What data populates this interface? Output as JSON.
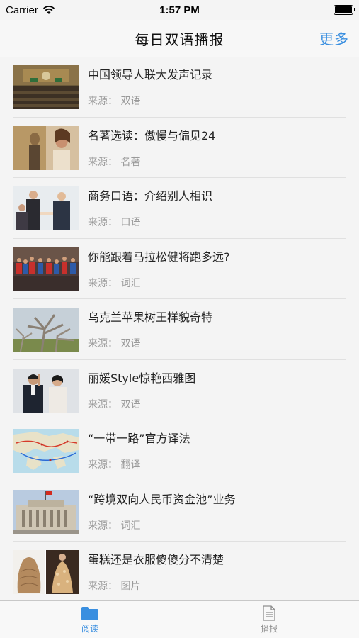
{
  "status_bar": {
    "carrier": "Carrier",
    "time": "1:57 PM"
  },
  "navbar": {
    "title": "每日双语播报",
    "more_label": "更多"
  },
  "articles": [
    {
      "title": "中国领导人联大发声记录",
      "source": "来源： 双语"
    },
    {
      "title": "名著选读：傲慢与偏见24",
      "source": "来源： 名著"
    },
    {
      "title": "商务口语：介绍别人相识",
      "source": "来源： 口语"
    },
    {
      "title": "你能跟着马拉松健将跑多远?",
      "source": "来源： 词汇"
    },
    {
      "title": "乌克兰苹果树王样貌奇特",
      "source": "来源： 双语"
    },
    {
      "title": "丽媛Style惊艳西雅图",
      "source": "来源： 双语"
    },
    {
      "title": "“一带一路”官方译法",
      "source": "来源： 翻译"
    },
    {
      "title": "“跨境双向人民币资金池”业务",
      "source": "来源： 词汇"
    },
    {
      "title": "蛋糕还是衣服傻傻分不清楚",
      "source": "来源： 图片"
    }
  ],
  "tabbar": {
    "tabs": [
      {
        "label": "阅读",
        "icon": "folder-icon",
        "active": true
      },
      {
        "label": "播报",
        "icon": "document-icon",
        "active": false
      }
    ]
  },
  "colors": {
    "accent": "#3a8fe0",
    "inactive": "#8e8e8e"
  }
}
